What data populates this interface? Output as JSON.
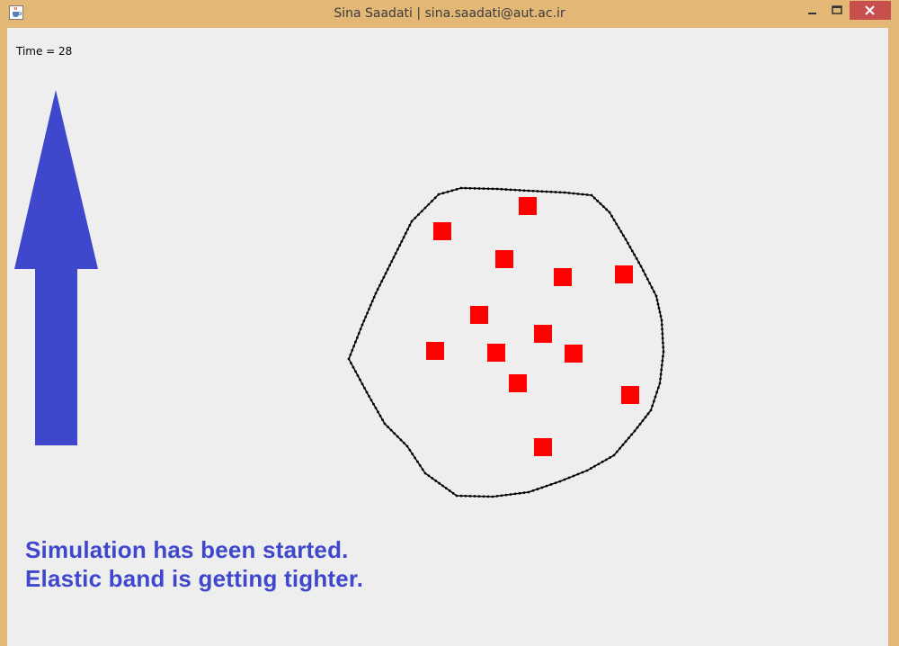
{
  "window": {
    "title": "Sina Saadati | sina.saadati@aut.ac.ir",
    "controls": [
      "minimize",
      "maximize",
      "close"
    ],
    "icon": "java-cup-icon"
  },
  "status": {
    "time_text": "Time = 28"
  },
  "indicator": {
    "icon": "up-arrow-icon",
    "color": "#3f48cc"
  },
  "messages": {
    "line1": "Simulation has been started.",
    "line2": "Elastic band is getting tighter."
  },
  "colors": {
    "accent": "#3f48cc",
    "obstacle": "#ff0000",
    "band": "#000000",
    "titlebar": "#e3b877",
    "close": "#c7504f",
    "canvas": "#eeeeee"
  },
  "simulation": {
    "obstacle_count": 13,
    "band": "elastic band around obstacles"
  }
}
